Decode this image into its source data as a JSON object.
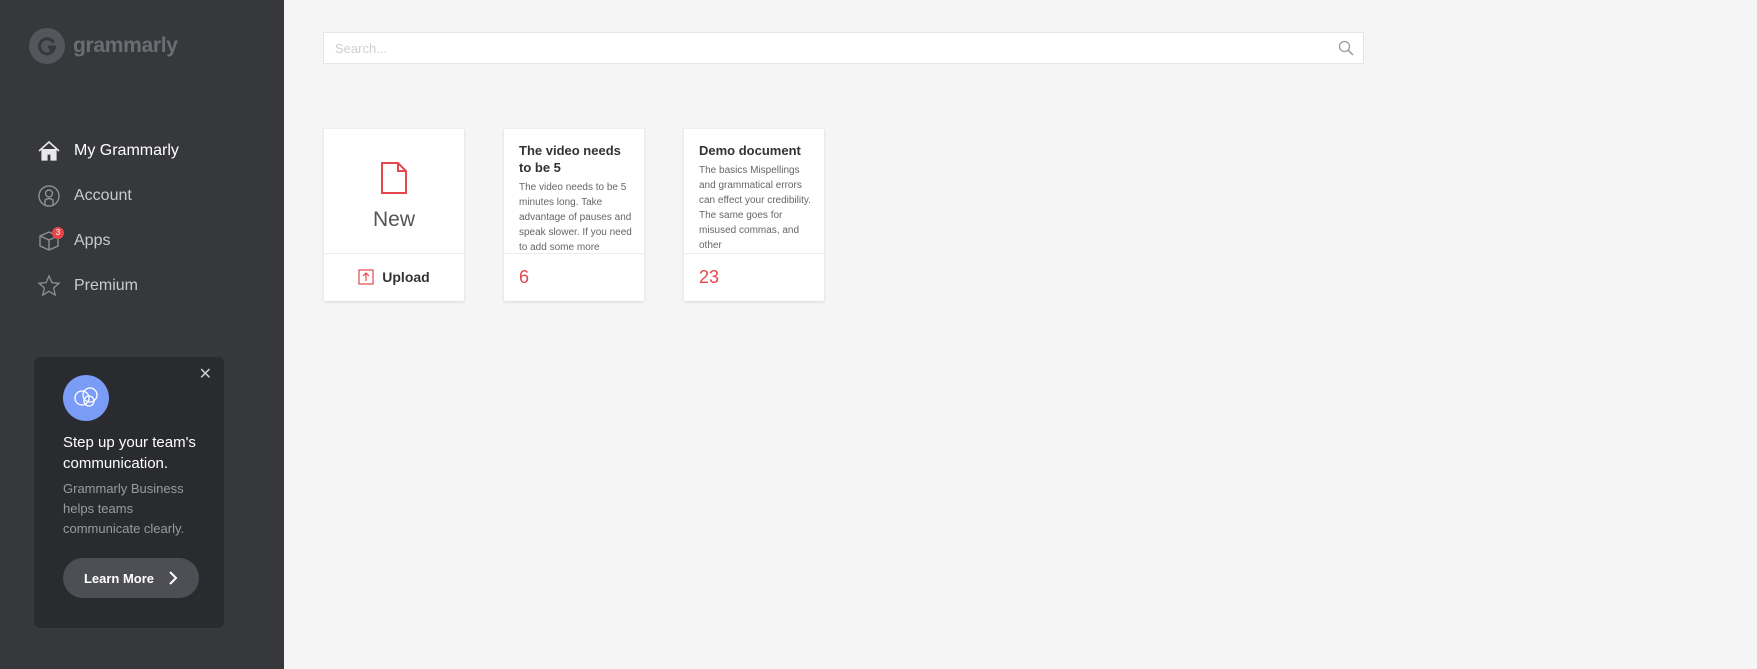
{
  "brand": {
    "name": "grammarly"
  },
  "nav": {
    "items": [
      {
        "label": "My Grammarly",
        "icon": "home-icon",
        "active": true
      },
      {
        "label": "Account",
        "icon": "account-icon"
      },
      {
        "label": "Apps",
        "icon": "apps-icon",
        "badge": "3"
      },
      {
        "label": "Premium",
        "icon": "star-icon"
      }
    ]
  },
  "promo": {
    "title": "Step up your team's communication.",
    "body": "Grammarly Business helps teams communicate clearly.",
    "button": "Learn More",
    "close": "✕"
  },
  "search": {
    "placeholder": "Search..."
  },
  "cards": {
    "new": {
      "label": "New",
      "upload": "Upload"
    },
    "docs": [
      {
        "title": "The video needs to be 5",
        "body": "The video needs to be 5 minutes long. Take advantage of pauses and speak slower. If you need to add some more",
        "count": "6"
      },
      {
        "title": "Demo document",
        "body": "The basics Mispellings and grammatical errors can effect your credibility. The same goes for misused commas, and other",
        "count": "23"
      }
    ]
  },
  "colors": {
    "accent": "#e5474d",
    "sidebar": "#37383c",
    "promo_avatar": "#7a9cf6"
  }
}
